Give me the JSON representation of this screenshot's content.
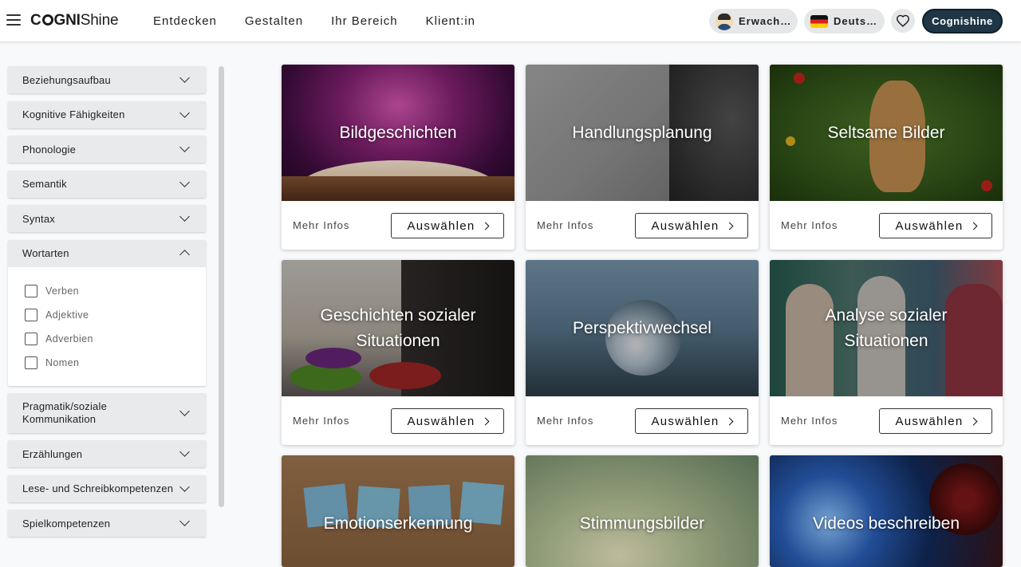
{
  "header": {
    "logo_prefix": "C",
    "logo_mid": "GNI",
    "logo_suffix": "Shine",
    "nav": [
      "Entdecken",
      "Gestalten",
      "Ihr Bereich",
      "Klient:in"
    ],
    "age_pill": "Erwachsene",
    "age_icon": "avatar-icon",
    "lang_pill": "Deutsch",
    "lang_icon": "german-flag-icon",
    "favorites_icon": "heart-icon",
    "brand_button": "Cognishine"
  },
  "sidebar": {
    "items": [
      {
        "label": "Beziehungsaufbau"
      },
      {
        "label": "Kognitive Fähigkeiten"
      },
      {
        "label": "Phonologie"
      },
      {
        "label": "Semantik"
      },
      {
        "label": "Syntax"
      }
    ],
    "open": {
      "label": "Wortarten",
      "options": [
        "Verben",
        "Adjektive",
        "Adverbien",
        "Nomen"
      ]
    },
    "items_after": [
      {
        "label": "Pragmatik/soziale Kommunikation"
      },
      {
        "label": "Erzählungen"
      },
      {
        "label": "Lese- und Schreibkompetenzen"
      },
      {
        "label": "Spielkompetenzen"
      }
    ]
  },
  "cards": [
    {
      "title": "Bildgeschichten",
      "more": "Mehr Infos",
      "select": "Auswählen"
    },
    {
      "title": "Handlungsplanung",
      "more": "Mehr Infos",
      "select": "Auswählen"
    },
    {
      "title": "Seltsame Bilder",
      "more": "Mehr Infos",
      "select": "Auswählen"
    },
    {
      "title": "Geschichten sozialer Situationen",
      "more": "Mehr Infos",
      "select": "Auswählen"
    },
    {
      "title": "Perspektivwechsel",
      "more": "Mehr Infos",
      "select": "Auswählen"
    },
    {
      "title": "Analyse sozialer Situationen",
      "more": "Mehr Infos",
      "select": "Auswählen"
    },
    {
      "title": "Emotionserkennung"
    },
    {
      "title": "Stimmungsbilder"
    },
    {
      "title": "Videos beschreiben"
    }
  ],
  "colors": {
    "brand_button_bg": "#1f3647",
    "accordion_bg": "#e9eaeb"
  }
}
